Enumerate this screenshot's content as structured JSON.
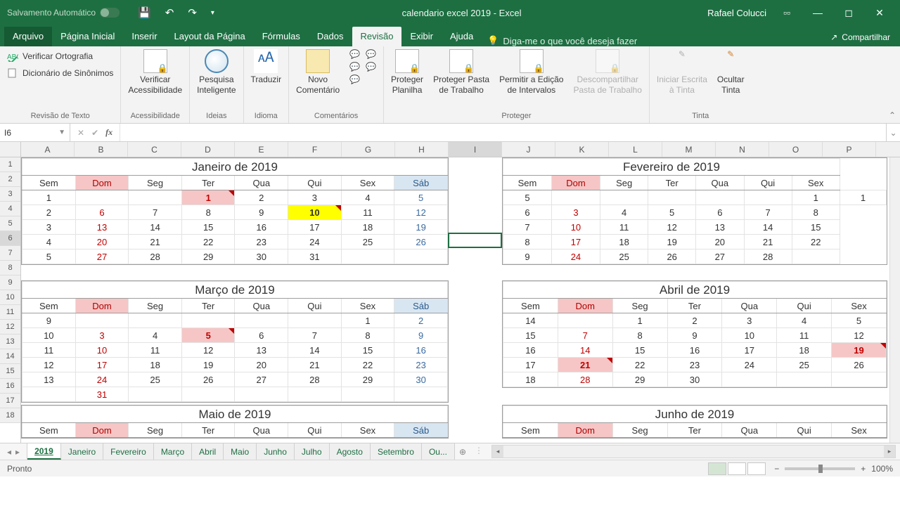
{
  "titlebar": {
    "autosave": "Salvamento Automático",
    "filename": "calendario excel 2019  -  Excel",
    "user": "Rafael Colucci"
  },
  "ribbon_tabs": [
    "Arquivo",
    "Página Inicial",
    "Inserir",
    "Layout da Página",
    "Fórmulas",
    "Dados",
    "Revisão",
    "Exibir",
    "Ajuda"
  ],
  "active_tab": "Revisão",
  "tellme": "Diga-me o que você deseja fazer",
  "share": "Compartilhar",
  "ribbon_groups": {
    "g0": {
      "label": "Revisão de Texto",
      "items": [
        "Verificar Ortografia",
        "Dicionário de Sinônimos"
      ]
    },
    "g1": {
      "label": "Acessibilidade",
      "item": "Verificar\nAcessibilidade"
    },
    "g2": {
      "label": "Ideias",
      "item": "Pesquisa\nInteligente"
    },
    "g3": {
      "label": "Idioma",
      "item": "Traduzir"
    },
    "g4": {
      "label": "Comentários",
      "item": "Novo\nComentário"
    },
    "g5": {
      "label": "Proteger",
      "items": [
        "Proteger\nPlanilha",
        "Proteger Pasta\nde Trabalho",
        "Permitir a Edição\nde Intervalos",
        "Descompartilhar\nPasta de Trabalho"
      ]
    },
    "g6": {
      "label": "Tinta",
      "items": [
        "Iniciar Escrita\nà Tinta",
        "Ocultar\nTinta"
      ]
    }
  },
  "namebox": "I6",
  "columns": [
    "A",
    "B",
    "C",
    "D",
    "E",
    "F",
    "G",
    "H",
    "I",
    "J",
    "K",
    "L",
    "M",
    "N",
    "O",
    "P"
  ],
  "month_titles": {
    "jan": "Janeiro de 2019",
    "fev": "Fevereiro de 2019",
    "mar": "Março de 2019",
    "abr": "Abril de 2019",
    "mai": "Maio de 2019",
    "jun": "Junho de 2019"
  },
  "dayhdr": [
    "Sem",
    "Dom",
    "Seg",
    "Ter",
    "Qua",
    "Qui",
    "Sex",
    "Sáb"
  ],
  "dayhdr7": [
    "Sem",
    "Dom",
    "Seg",
    "Ter",
    "Qua",
    "Qui",
    "Sex"
  ],
  "jan": [
    [
      "1",
      "",
      "",
      "1",
      "2",
      "3",
      "4",
      "5"
    ],
    [
      "2",
      "6",
      "7",
      "8",
      "9",
      "10",
      "11",
      "12"
    ],
    [
      "3",
      "13",
      "14",
      "15",
      "16",
      "17",
      "18",
      "19"
    ],
    [
      "4",
      "20",
      "21",
      "22",
      "23",
      "24",
      "25",
      "26"
    ],
    [
      "5",
      "27",
      "28",
      "29",
      "30",
      "31",
      "",
      ""
    ]
  ],
  "fev": [
    [
      "5",
      "",
      "",
      "",
      "",
      "",
      "1",
      "1"
    ],
    [
      "6",
      "3",
      "4",
      "5",
      "6",
      "7",
      "8"
    ],
    [
      "7",
      "10",
      "11",
      "12",
      "13",
      "14",
      "15"
    ],
    [
      "8",
      "17",
      "18",
      "19",
      "20",
      "21",
      "22"
    ],
    [
      "9",
      "24",
      "25",
      "26",
      "27",
      "28",
      ""
    ]
  ],
  "mar": [
    [
      "9",
      "",
      "",
      "",
      "",
      "",
      "1",
      "2"
    ],
    [
      "10",
      "3",
      "4",
      "5",
      "6",
      "7",
      "8",
      "9"
    ],
    [
      "11",
      "10",
      "11",
      "12",
      "13",
      "14",
      "15",
      "16"
    ],
    [
      "12",
      "17",
      "18",
      "19",
      "20",
      "21",
      "22",
      "23"
    ],
    [
      "13",
      "24",
      "25",
      "26",
      "27",
      "28",
      "29",
      "30"
    ],
    [
      "",
      "31",
      "",
      "",
      "",
      "",
      "",
      ""
    ]
  ],
  "abr": [
    [
      "14",
      "",
      "1",
      "2",
      "3",
      "4",
      "5"
    ],
    [
      "15",
      "7",
      "8",
      "9",
      "10",
      "11",
      "12"
    ],
    [
      "16",
      "14",
      "15",
      "16",
      "17",
      "18",
      "19"
    ],
    [
      "17",
      "21",
      "22",
      "23",
      "24",
      "25",
      "26"
    ],
    [
      "18",
      "28",
      "29",
      "30",
      "",
      "",
      ""
    ]
  ],
  "sheet_tabs": [
    "2019",
    "Janeiro",
    "Fevereiro",
    "Março",
    "Abril",
    "Maio",
    "Junho",
    "Julho",
    "Agosto",
    "Setembro",
    "Ou..."
  ],
  "status": "Pronto",
  "zoom": "100%"
}
